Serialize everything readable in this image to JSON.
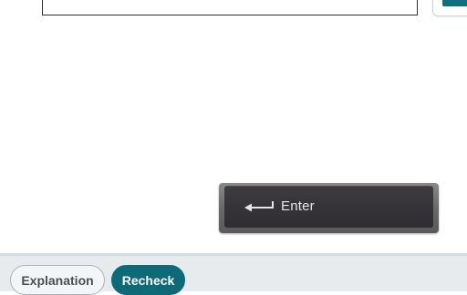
{
  "enter_key": {
    "label": "Enter",
    "icon": "return-arrow-icon"
  },
  "actions": {
    "explanation_label": "Explanation",
    "recheck_label": "Recheck"
  },
  "colors": {
    "accent": "#0f6f7e",
    "recheck_bg": "#0f6a78",
    "bar_bg": "#e7ebee",
    "key_cap": "#353337"
  }
}
